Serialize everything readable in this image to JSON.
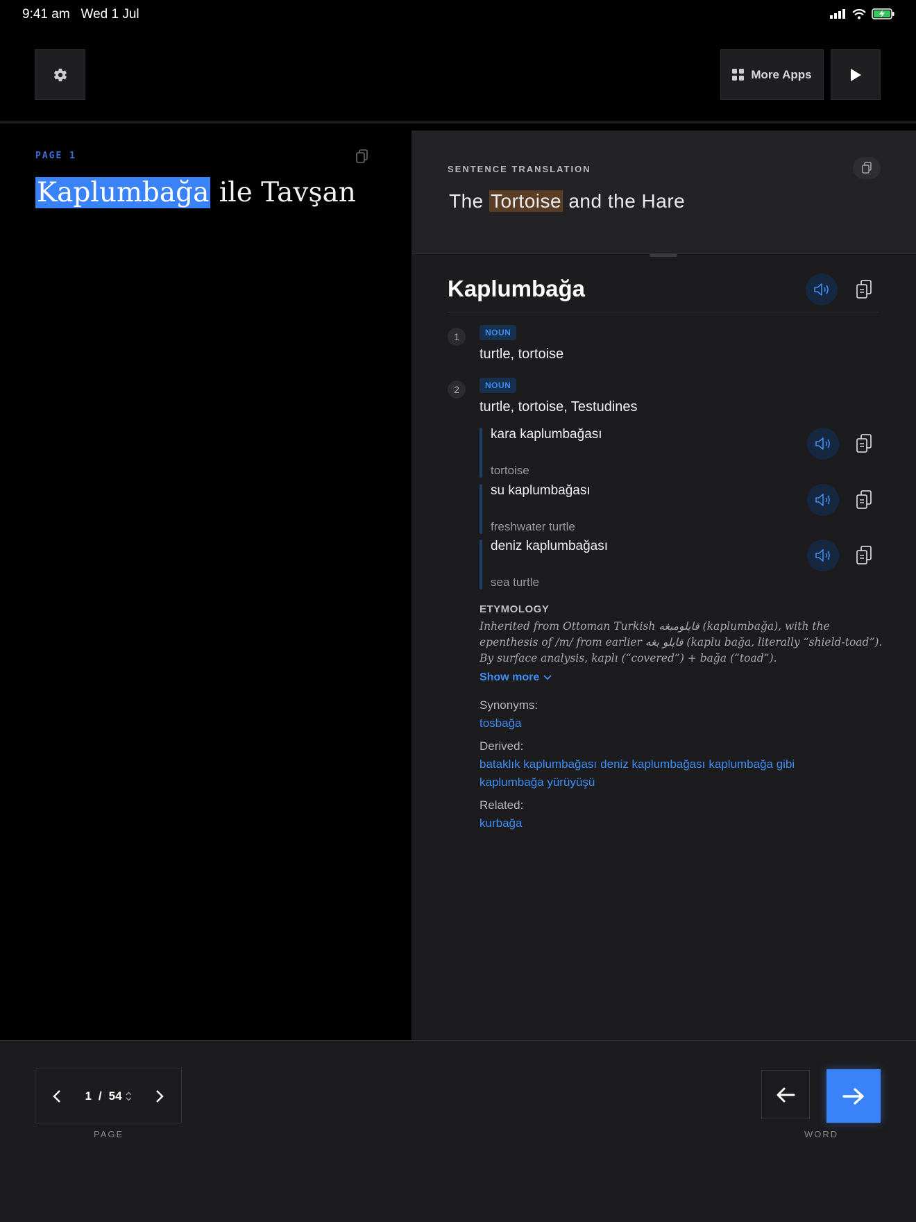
{
  "status_bar": {
    "time": "9:41 am",
    "date": "Wed 1 Jul"
  },
  "toolbar": {
    "more_apps_label": "More Apps"
  },
  "left": {
    "page_label": "PAGE 1",
    "title_highlight": "Kaplumbağa",
    "title_rest": " ile Tavşan"
  },
  "translation": {
    "label": "SENTENCE TRANSLATION",
    "before": "The ",
    "highlight": "Tortoise",
    "after": " and the Hare"
  },
  "entry": {
    "word": "Kaplumbağa",
    "senses": [
      {
        "num": "1",
        "pos": "NOUN",
        "gloss": "turtle, tortoise"
      },
      {
        "num": "2",
        "pos": "NOUN",
        "gloss": "turtle, tortoise, Testudines"
      }
    ],
    "examples": [
      {
        "term": "kara kaplumbağası",
        "translation": "tortoise"
      },
      {
        "term": "su kaplumbağası",
        "translation": "freshwater turtle"
      },
      {
        "term": "deniz kaplumbağası",
        "translation": "sea turtle"
      }
    ],
    "etymology_label": "ETYMOLOGY",
    "etymology_text": "Inherited from Ottoman Turkish قاپلومبغه (kaplumbağa), with the epenthesis of /m/ from earlier قاپلو بغه (kaplu bağa, literally “shield-toad”). By surface analysis, kaplı (“covered”) + bağa (“toad”).",
    "show_more": "Show more",
    "synonyms_label": "Synonyms:",
    "synonyms": [
      "tosbağa"
    ],
    "derived_label": "Derived:",
    "derived": [
      "bataklık kaplumbağası",
      "deniz kaplumbağası",
      "kaplumbağa gibi",
      "kaplumbağa yürüyüşü"
    ],
    "related_label": "Related:",
    "related": [
      "kurbağa"
    ]
  },
  "pager": {
    "current": "1",
    "separator": "/",
    "total": "54",
    "label": "PAGE"
  },
  "word_nav": {
    "label": "WORD"
  },
  "colors": {
    "accent": "#3a82f7",
    "highlight_brown": "#5a3d25",
    "badge_bg": "#17304d"
  }
}
